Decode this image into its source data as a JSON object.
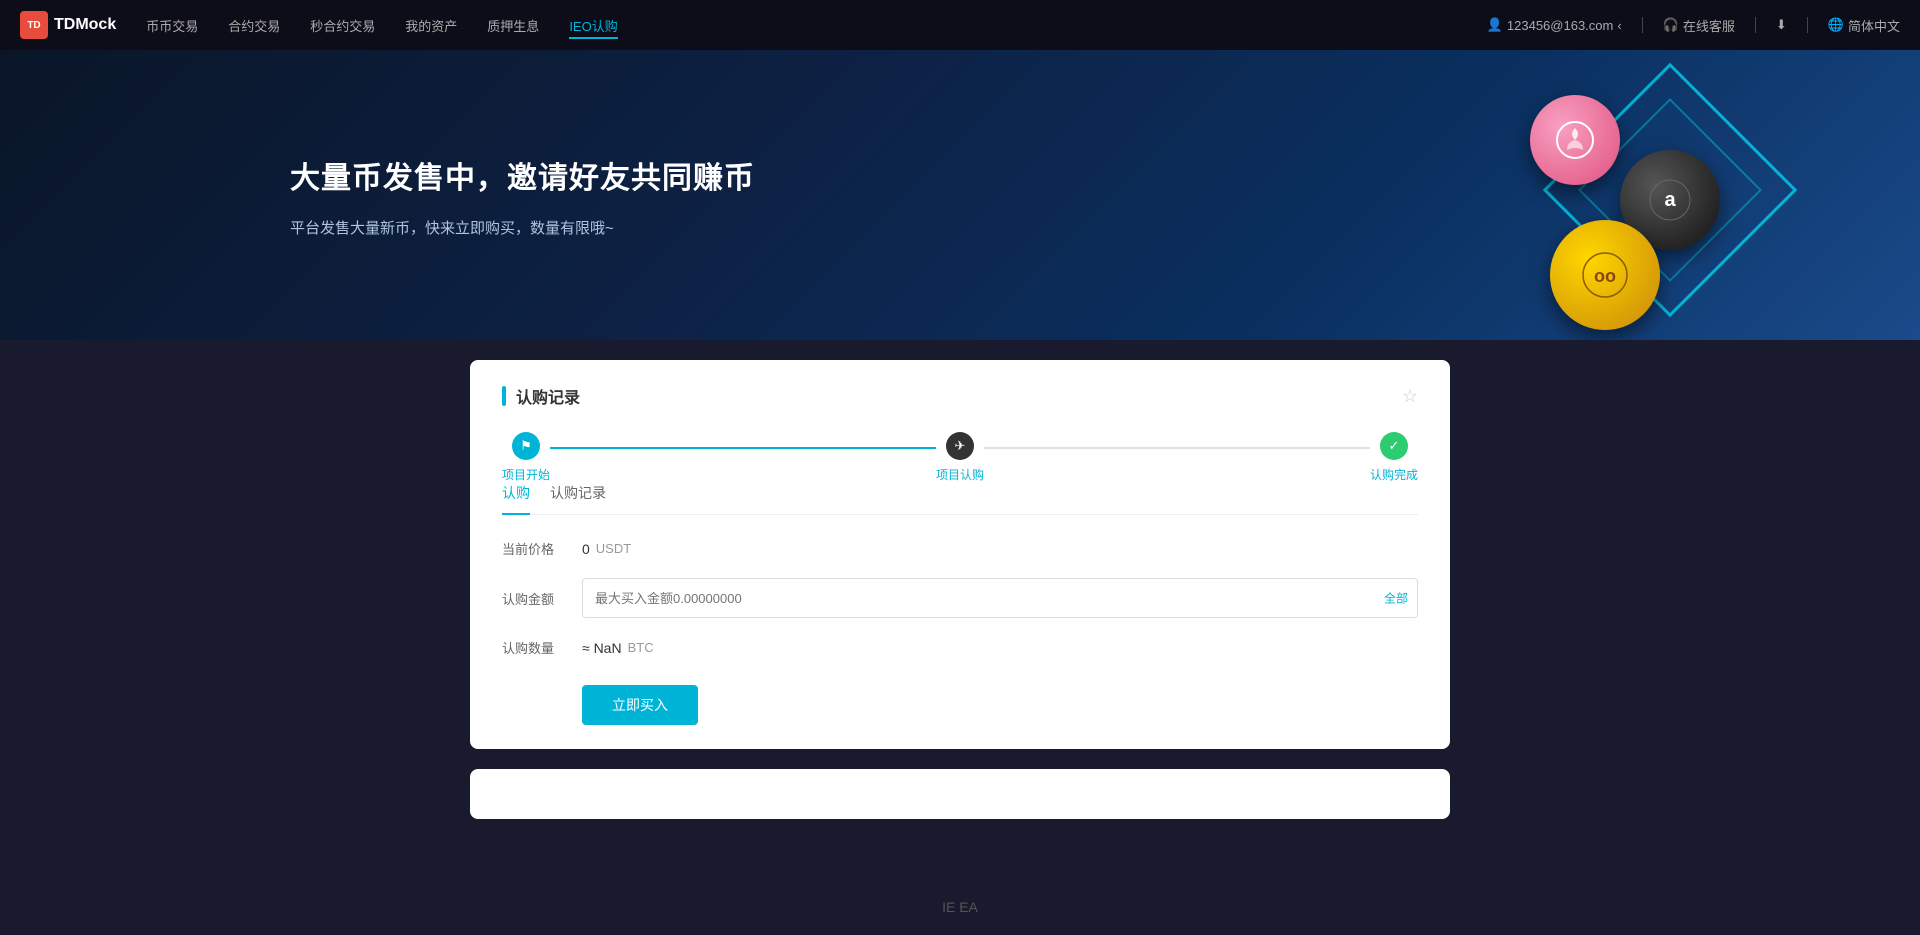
{
  "app": {
    "logo_text": "TDMock",
    "logo_icon": "TD"
  },
  "navbar": {
    "items": [
      {
        "label": "币币交易",
        "active": false
      },
      {
        "label": "合约交易",
        "active": false
      },
      {
        "label": "秒合约交易",
        "active": false
      },
      {
        "label": "我的资产",
        "active": false
      },
      {
        "label": "质押生息",
        "active": false
      },
      {
        "label": "IEO认购",
        "active": true
      }
    ],
    "user_email": "123456@163.com",
    "customer_service": "在线客服",
    "language": "简体中文"
  },
  "hero": {
    "title": "大量币发售中，邀请好友共同赚币",
    "subtitle": "平台发售大量新币，快来立即购买，数量有限哦~"
  },
  "card": {
    "title": "认购记录",
    "steps": [
      {
        "label": "项目开始",
        "icon": "flag",
        "status": "active"
      },
      {
        "label": "项目认购",
        "icon": "paper-plane",
        "status": "active"
      },
      {
        "label": "认购完成",
        "icon": "check",
        "status": "complete"
      }
    ],
    "tabs": [
      {
        "label": "认购",
        "active": true
      },
      {
        "label": "认购记录",
        "active": false
      }
    ],
    "current_price_label": "当前价格",
    "current_price_value": "0",
    "current_price_unit": "USDT",
    "subscription_amount_label": "认购金额",
    "subscription_amount_placeholder": "最大买入金额0.00000000",
    "subscription_amount_suffix": "全部",
    "subscription_quantity_label": "认购数量",
    "subscription_quantity_value": "≈ NaN",
    "subscription_quantity_unit": "BTC",
    "buy_button_label": "立即买入"
  },
  "bottom_label": "IE EA"
}
